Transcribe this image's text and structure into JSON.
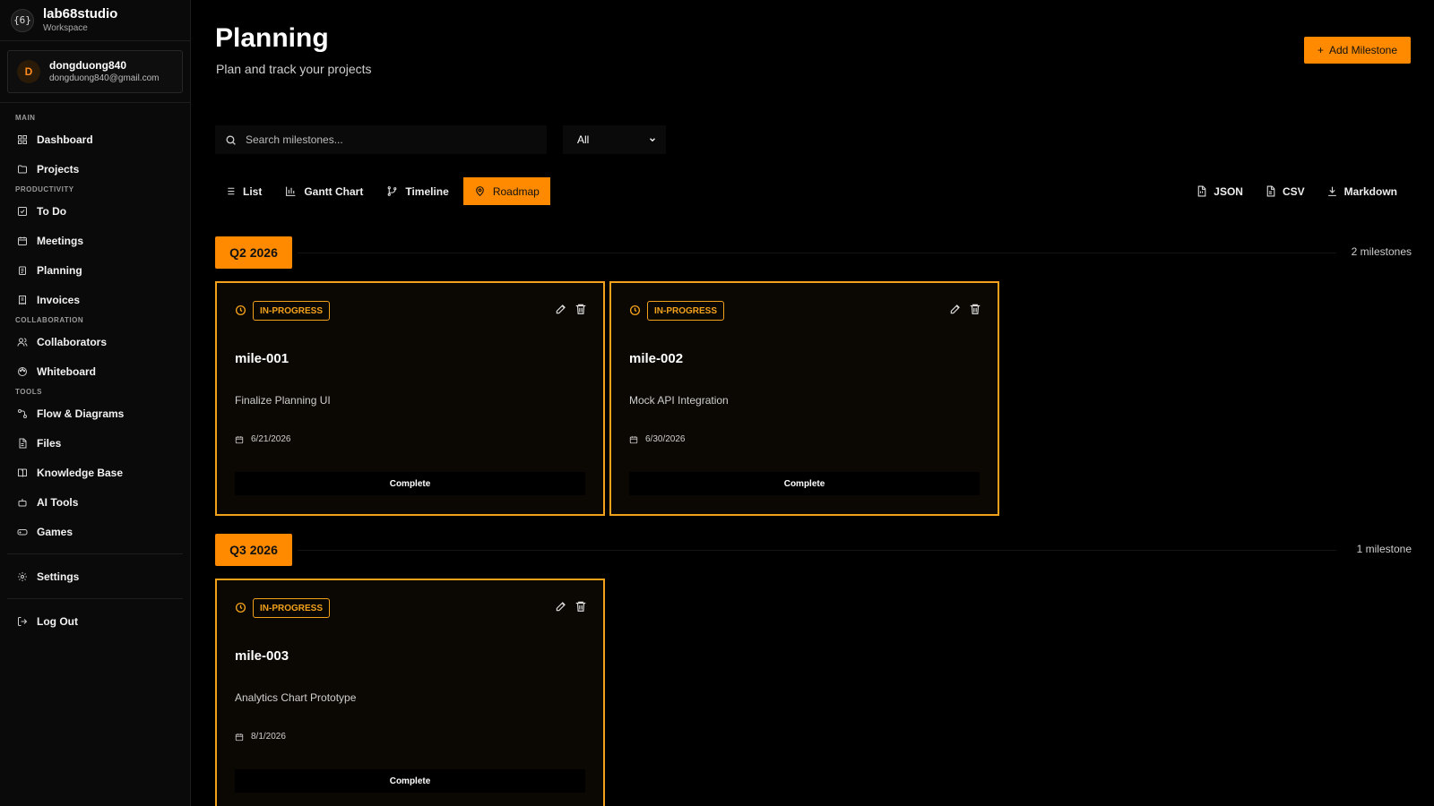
{
  "brand": {
    "name": "lab68studio",
    "subtitle": "Workspace",
    "logo_glyph": "{6}"
  },
  "user": {
    "initial": "D",
    "name": "dongduong840",
    "email": "dongduong840@gmail.com"
  },
  "sidebar": {
    "sections": [
      {
        "label": "MAIN",
        "items": [
          {
            "label": "Dashboard",
            "icon": "grid-icon"
          },
          {
            "label": "Projects",
            "icon": "folder-icon"
          }
        ]
      },
      {
        "label": "PRODUCTIVITY",
        "items": [
          {
            "label": "To Do",
            "icon": "checkbox-icon"
          },
          {
            "label": "Meetings",
            "icon": "calendar-icon"
          },
          {
            "label": "Planning",
            "icon": "clipboard-icon"
          },
          {
            "label": "Invoices",
            "icon": "receipt-icon"
          }
        ]
      },
      {
        "label": "COLLABORATION",
        "items": [
          {
            "label": "Collaborators",
            "icon": "users-icon"
          },
          {
            "label": "Whiteboard",
            "icon": "palette-icon"
          }
        ]
      },
      {
        "label": "TOOLS",
        "items": [
          {
            "label": "Flow & Diagrams",
            "icon": "flow-icon"
          },
          {
            "label": "Files",
            "icon": "file-icon"
          },
          {
            "label": "Knowledge Base",
            "icon": "book-icon"
          },
          {
            "label": "AI Tools",
            "icon": "bot-icon"
          },
          {
            "label": "Games",
            "icon": "gamepad-icon"
          }
        ]
      }
    ],
    "settings_label": "Settings",
    "logout_label": "Log Out"
  },
  "header": {
    "title": "Planning",
    "subtitle": "Plan and track your projects",
    "add_label": "Add Milestone"
  },
  "search": {
    "placeholder": "Search milestones...",
    "value": ""
  },
  "filter": {
    "selected": "All"
  },
  "views": [
    "List",
    "Gantt Chart",
    "Timeline",
    "Roadmap"
  ],
  "active_view": "Roadmap",
  "exports": [
    "JSON",
    "CSV",
    "Markdown"
  ],
  "quarters": [
    {
      "label": "Q2 2026",
      "count": "2 milestones",
      "milestones": [
        {
          "status": "IN-PROGRESS",
          "id": "mile-001",
          "description": "Finalize Planning UI",
          "date": "6/21/2026",
          "action": "Complete"
        },
        {
          "status": "IN-PROGRESS",
          "id": "mile-002",
          "description": "Mock API Integration",
          "date": "6/30/2026",
          "action": "Complete"
        }
      ]
    },
    {
      "label": "Q3 2026",
      "count": "1 milestone",
      "milestones": [
        {
          "status": "IN-PROGRESS",
          "id": "mile-003",
          "description": "Analytics Chart Prototype",
          "date": "8/1/2026",
          "action": "Complete"
        }
      ]
    }
  ],
  "colors": {
    "accent": "#ff8a00",
    "card_border": "#f2a11b",
    "background": "#000000",
    "sidebar": "#0a0a0a"
  }
}
